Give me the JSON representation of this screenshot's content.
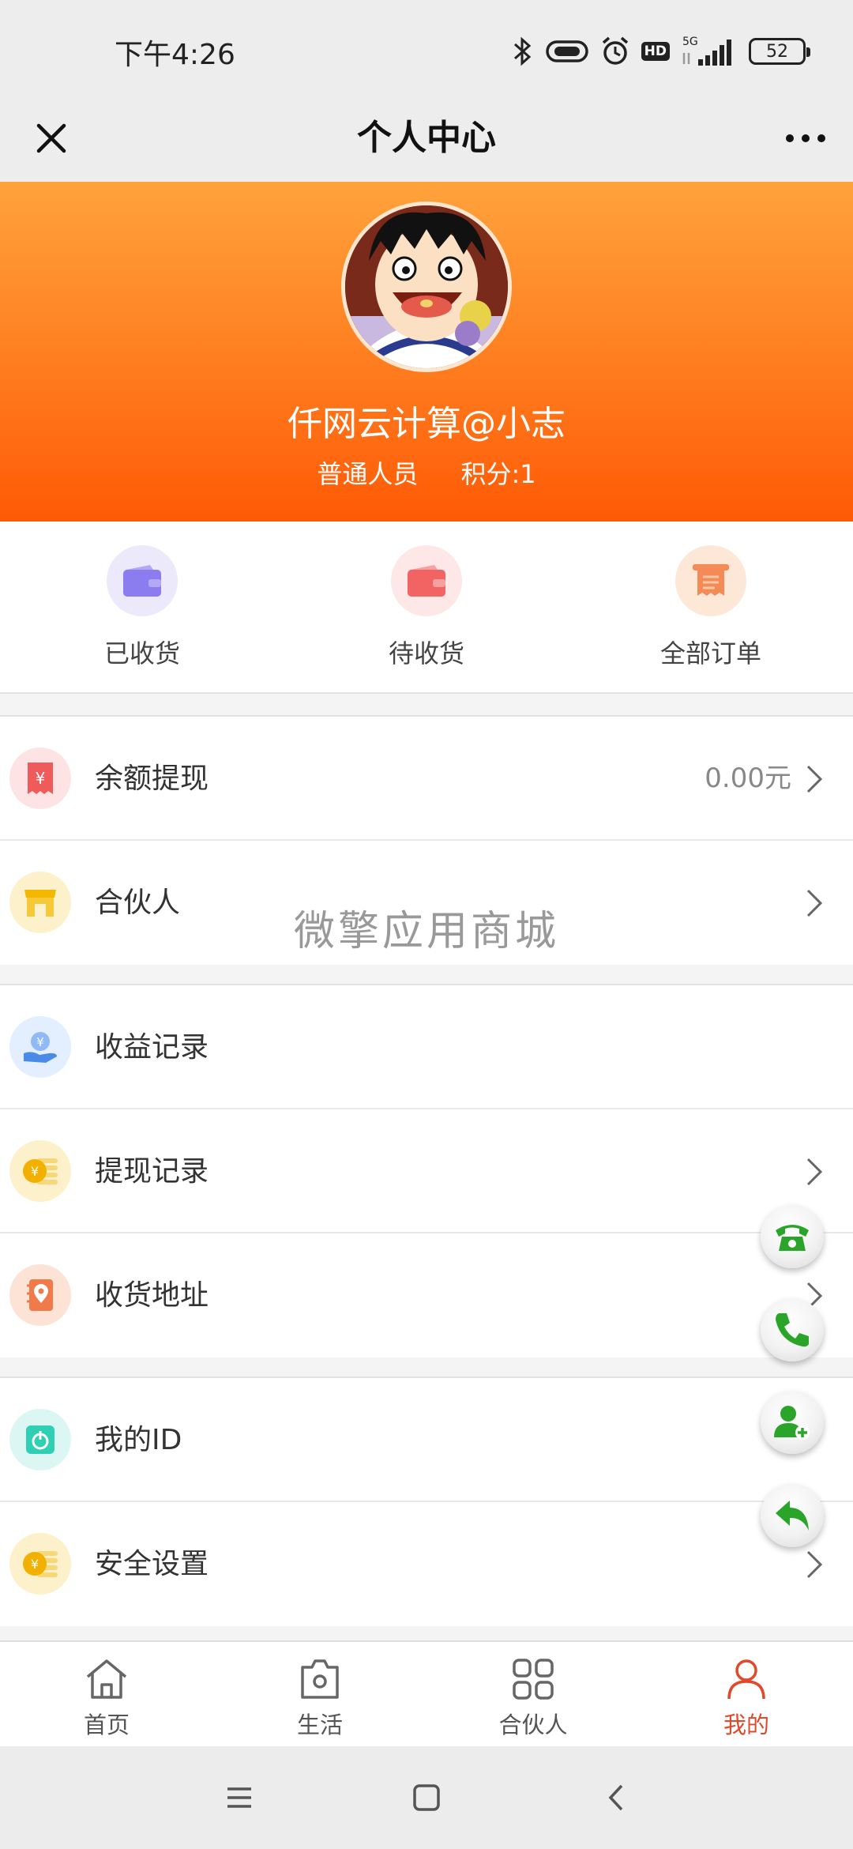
{
  "status_bar": {
    "time": "下午4:26",
    "hd": "HD",
    "network": "5G",
    "battery": "52"
  },
  "nav": {
    "title": "个人中心"
  },
  "profile": {
    "name": "仟网云计算@小志",
    "role": "普通人员",
    "points": "积分:1"
  },
  "orders": [
    {
      "label": "已收货",
      "icon": "wallet-icon",
      "bg": "#ece9fb",
      "color": "#8b7cf0"
    },
    {
      "label": "待收货",
      "icon": "wallet-icon",
      "bg": "#fde7e7",
      "color": "#f26464"
    },
    {
      "label": "全部订单",
      "icon": "scroll-icon",
      "bg": "#fde8d8",
      "color": "#f48a55"
    }
  ],
  "menu": {
    "balance": {
      "label": "余额提现",
      "value": "0.00元"
    },
    "partner": {
      "label": "合伙人"
    },
    "income": {
      "label": "收益记录"
    },
    "withdraw_records": {
      "label": "提现记录"
    },
    "address": {
      "label": "收货地址"
    },
    "my_id": {
      "label": "我的ID"
    },
    "security": {
      "label": "安全设置"
    }
  },
  "watermark": "微擎应用商城",
  "tabs": [
    {
      "label": "首页",
      "icon": "home-icon"
    },
    {
      "label": "生活",
      "icon": "camera-bag-icon"
    },
    {
      "label": "合伙人",
      "icon": "grid-icon"
    },
    {
      "label": "我的",
      "icon": "user-icon",
      "active": true
    }
  ],
  "colors": {
    "header_top": "#ffa33c",
    "header_bottom": "#ff5a06",
    "active_tab": "#e2492b",
    "fab_green": "#2aa52a"
  }
}
